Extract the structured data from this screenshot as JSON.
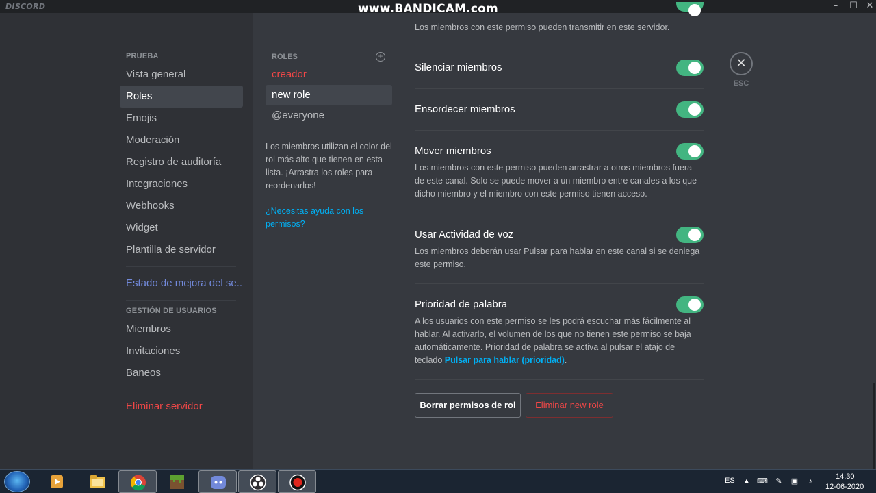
{
  "app": {
    "brand": "DISCORD",
    "watermark": "www.BANDICAM.com"
  },
  "window_controls": {
    "minimize": "–",
    "maximize": "☐",
    "close": "✕"
  },
  "sidebar": {
    "server_header": "PRUEBA",
    "items": [
      {
        "label": "Vista general"
      },
      {
        "label": "Roles"
      },
      {
        "label": "Emojis"
      },
      {
        "label": "Moderación"
      },
      {
        "label": "Registro de auditoría"
      },
      {
        "label": "Integraciones"
      },
      {
        "label": "Webhooks"
      },
      {
        "label": "Widget"
      },
      {
        "label": "Plantilla de servidor"
      }
    ],
    "boost_label": "Estado de mejora del se...",
    "users_header": "GESTIÓN DE USUARIOS",
    "user_items": [
      {
        "label": "Miembros"
      },
      {
        "label": "Invitaciones"
      },
      {
        "label": "Baneos"
      }
    ],
    "delete_server": "Eliminar servidor"
  },
  "roles": {
    "header": "ROLES",
    "add_icon": "+",
    "list": [
      {
        "label": "creador"
      },
      {
        "label": "new role"
      },
      {
        "label": "@everyone"
      }
    ],
    "help_text": "Los miembros utilizan el color del rol más alto que tienen en esta lista. ¡Arrastra los roles para reordenarlos!",
    "help_link": "¿Necesitas ayuda con los permisos?"
  },
  "permissions": {
    "stream_desc": "Los miembros con este permiso pueden transmitir en este servidor.",
    "mute": {
      "title": "Silenciar miembros",
      "enabled": true
    },
    "deafen": {
      "title": "Ensordecer miembros",
      "enabled": true
    },
    "move": {
      "title": "Mover miembros",
      "enabled": true,
      "desc": "Los miembros con este permiso pueden arrastrar a otros miembros fuera de este canal. Solo se puede mover a un miembro entre canales a los que dicho miembro y el miembro con este permiso tienen acceso."
    },
    "vad": {
      "title": "Usar Actividad de voz",
      "enabled": true,
      "desc": "Los miembros deberán usar Pulsar para hablar en este canal si se deniega este permiso."
    },
    "priority": {
      "title": "Prioridad de palabra",
      "enabled": true,
      "desc": "A los usuarios con este permiso se les podrá escuchar más fácilmente al hablar. Al activarlo, el volumen de los que no tienen este permiso se baja automáticamente. Prioridad de palabra se activa al pulsar el atajo de teclado ",
      "desc_strong": "Pulsar para hablar (prioridad)",
      "desc_end": "."
    }
  },
  "buttons": {
    "reset": "Borrar permisos de rol",
    "delete_role": "Eliminar new role"
  },
  "close": {
    "icon": "✕",
    "label": "ESC"
  },
  "taskbar": {
    "lang": "ES",
    "time": "14:30",
    "date": "12-06-2020"
  },
  "colors": {
    "accent_green": "#43b581",
    "danger_red": "#f04747",
    "link_blue": "#00b0f4",
    "blurple": "#7289da"
  }
}
